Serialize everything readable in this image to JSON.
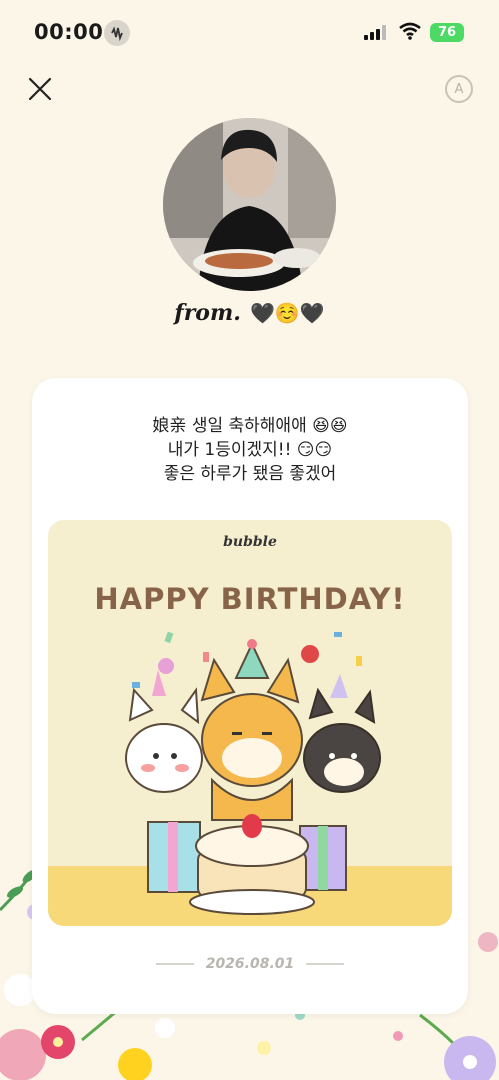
{
  "status_bar": {
    "time": "00:00",
    "battery": "76"
  },
  "post": {
    "from_label": "from.",
    "from_emoji": "🖤☺️🖤",
    "message_lines": [
      "娘亲 생일 축하해애애 😆😆",
      "내가 1등이겠지!! 😏😏",
      "좋은 하루가 됐음 좋겠어"
    ],
    "date": "2026.08.01"
  },
  "birthday_card": {
    "logo": "bubble",
    "title": "HAPPY BIRTHDAY!"
  },
  "colors": {
    "background": "#fbf6e8",
    "card_title": "#87634a",
    "battery": "#4cd964"
  }
}
